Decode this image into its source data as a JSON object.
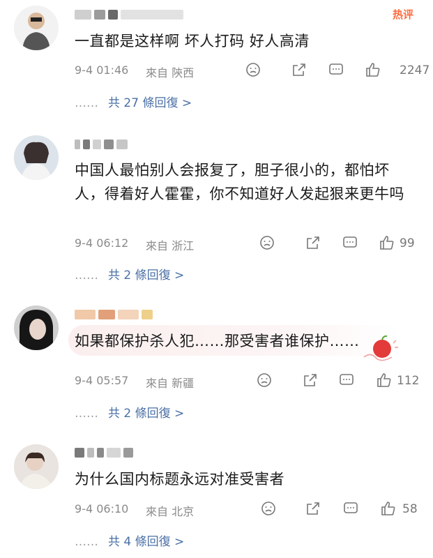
{
  "hot_label": "热评",
  "comments": [
    {
      "text": "一直都是这样啊 坏人打码 好人高清",
      "time": "9-4 01:46",
      "location": "來自 陝西",
      "likes": "2247",
      "replies_prefix": "……",
      "replies_link": "共 27 條回復 >"
    },
    {
      "text": "中国人最怕别人会报复了，胆子很小的，都怕坏人，得着好人霍霍，你不知道好人发起狠来更牛吗",
      "time": "9-4 06:12",
      "location": "來自 浙江",
      "likes": "99",
      "replies_prefix": "……",
      "replies_link": "共 2 條回復 >"
    },
    {
      "text": "如果都保护杀人犯……那受害者谁保护……",
      "time": "9-4 05:57",
      "location": "來自 新疆",
      "likes": "112",
      "replies_prefix": "……",
      "replies_link": "共 2 條回復 >"
    },
    {
      "text": "为什么国内标题永远对准受害者",
      "time": "9-4 06:10",
      "location": "來自 北京",
      "likes": "58",
      "replies_prefix": "……",
      "replies_link": "共 4 條回復 >"
    }
  ],
  "icons": [
    "dislike-icon",
    "repost-icon",
    "comment-icon",
    "like-icon"
  ],
  "colors": {
    "link": "#4a6fa5",
    "meta": "#8a8a8a",
    "hot": "#ff6a3d"
  }
}
